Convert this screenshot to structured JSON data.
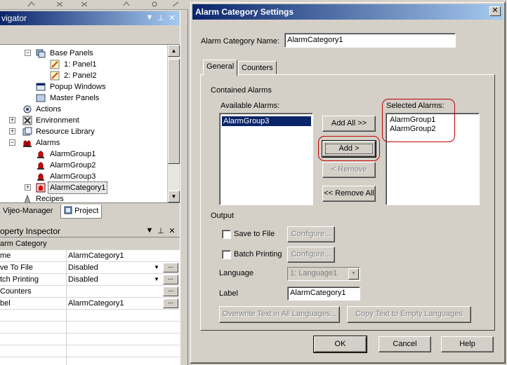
{
  "navigator": {
    "title": "vigator",
    "tree": [
      {
        "label": "Base Panels"
      },
      {
        "label": "1: Panel1"
      },
      {
        "label": "2: Panel2"
      },
      {
        "label": "Popup Windows"
      },
      {
        "label": "Master Panels"
      },
      {
        "label": "Actions"
      },
      {
        "label": "Environment"
      },
      {
        "label": "Resource Library"
      },
      {
        "label": "Alarms"
      },
      {
        "label": "AlarmGroup1"
      },
      {
        "label": "AlarmGroup2"
      },
      {
        "label": "AlarmGroup3"
      },
      {
        "label": "AlarmCategory1"
      },
      {
        "label": "Recipes"
      }
    ],
    "tabs": [
      "Vijeo-Manager",
      "Project"
    ]
  },
  "property_inspector": {
    "title": "operty Inspector",
    "header": {
      "name": "arm Category",
      "value": ""
    },
    "rows": [
      {
        "name": "me",
        "value": "AlarmCategory1"
      },
      {
        "name": "ve To File",
        "value": "Disabled"
      },
      {
        "name": "tch Printing",
        "value": "Disabled"
      },
      {
        "name": "Counters",
        "value": ""
      },
      {
        "name": "bel",
        "value": "AlarmCategory1"
      }
    ]
  },
  "dialog": {
    "title": "Alarm Category Settings",
    "close_label": "✕",
    "category_name_label": "Alarm Category Name:",
    "category_name_value": "AlarmCategory1",
    "tabs": [
      "General",
      "Counters"
    ],
    "contained_alarms_label": "Contained Alarms",
    "available_label": "Available Alarms:",
    "available_items": [
      "AlarmGroup3"
    ],
    "selected_label": "Selected Alarms:",
    "selected_items": [
      "AlarmGroup1",
      "AlarmGroup2"
    ],
    "buttons": {
      "add_all": "Add All >>",
      "add": "Add >",
      "remove": "< Remove",
      "remove_all": "<< Remove All"
    },
    "output": {
      "label": "Output",
      "save_to_file": "Save to File",
      "batch_printing": "Batch Printing",
      "configure": "Configure...",
      "language_label": "Language",
      "language_value": "1: Language1",
      "label_label": "Label",
      "label_value": "AlarmCategory1",
      "overwrite_text": "Overwrite Text in All Languages...",
      "copy_text": "Copy Text to Empty Languages"
    },
    "ok": "OK",
    "cancel": "Cancel",
    "help": "Help"
  }
}
